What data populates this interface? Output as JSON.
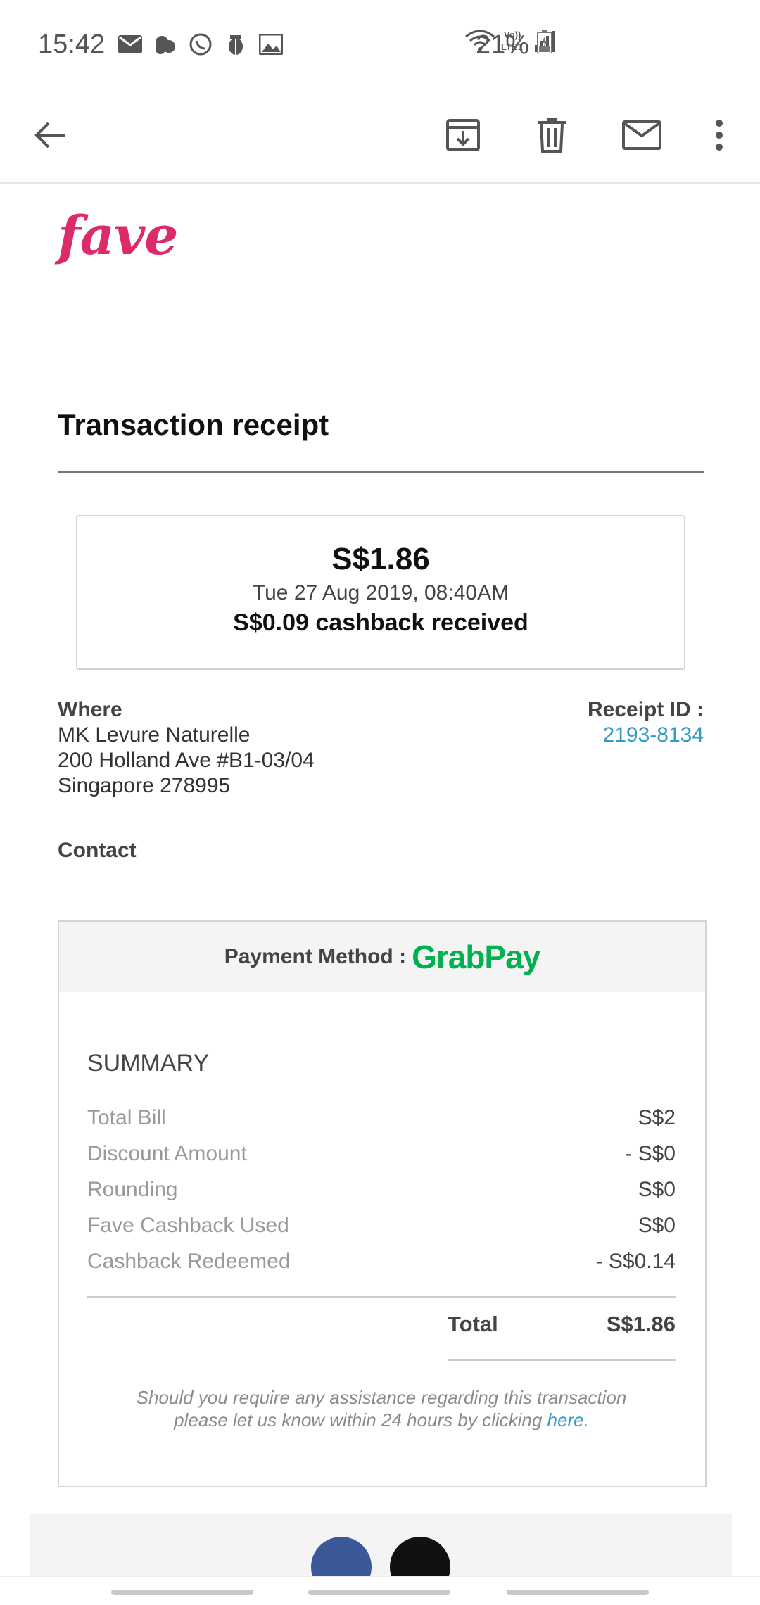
{
  "status_bar": {
    "time": "15:42",
    "battery": "21%",
    "icons": [
      "mail-icon",
      "cloud-icon",
      "whatsapp-icon",
      "bug-icon",
      "image-icon",
      "wifi-icon",
      "lte-icon",
      "signal-icon",
      "battery-icon"
    ]
  },
  "app_bar": {
    "icons": [
      "back-arrow-icon",
      "archive-icon",
      "delete-icon",
      "mail-icon",
      "more-vert-icon"
    ]
  },
  "email": {
    "brand_logo": "fave",
    "title": "Transaction receipt",
    "amount": "S$1.86",
    "datetime": "Tue 27 Aug 2019, 08:40AM",
    "cashback": "S$0.09 cashback received",
    "where_label": "Where",
    "where_lines": [
      "MK Levure Naturelle",
      "200 Holland Ave #B1-03/04",
      "Singapore 278995"
    ],
    "receipt_label": "Receipt ID :",
    "receipt_id": "2193-8134",
    "contact_label": "Contact",
    "payment_label": "Payment Method :",
    "payment_brand": "GrabPay",
    "summary_title": "SUMMARY",
    "summary_rows": [
      {
        "label": "Total Bill",
        "value": "S$2"
      },
      {
        "label": "Discount Amount",
        "value": "- S$0"
      },
      {
        "label": "Rounding",
        "value": "S$0"
      },
      {
        "label": "Fave Cashback Used",
        "value": "S$0"
      },
      {
        "label": "Cashback Redeemed",
        "value": "- S$0.14"
      }
    ],
    "total_label": "Total",
    "total_value": "S$1.86",
    "assist_line1": "Should you require any assistance regarding this transaction",
    "assist_line2": "please let us know within 24 hours by clicking ",
    "assist_link": "here",
    "assist_end": "."
  },
  "colors": {
    "brand": "#dd2a6b",
    "link": "#2e9cc4",
    "grabpay": "#00b14f"
  }
}
